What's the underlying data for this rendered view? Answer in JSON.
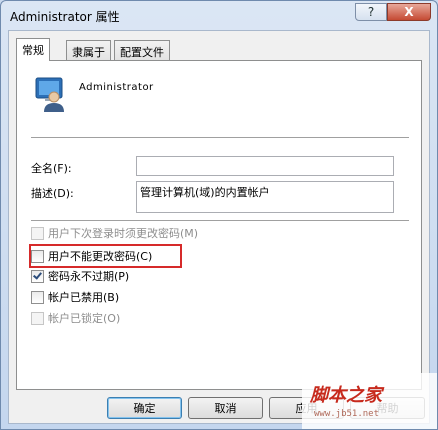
{
  "window": {
    "title": "Administrator 属性",
    "help_label": "?",
    "close_label": "X"
  },
  "tabs": [
    {
      "label": "常规",
      "active": true
    },
    {
      "label": "隶属于",
      "active": false
    },
    {
      "label": "配置文件",
      "active": false
    }
  ],
  "general": {
    "user_name": "Administrator",
    "full_name_label": "全名(F):",
    "full_name_value": "",
    "description_label": "描述(D):",
    "description_value": "管理计算机(域)的内置帐户",
    "checkboxes": [
      {
        "label": "用户下次登录时须更改密码(M)",
        "checked": false,
        "enabled": false
      },
      {
        "label": "用户不能更改密码(C)",
        "checked": false,
        "enabled": true
      },
      {
        "label": "密码永不过期(P)",
        "checked": true,
        "enabled": true
      },
      {
        "label": "帐户已禁用(B)",
        "checked": false,
        "enabled": true
      },
      {
        "label": "帐户已锁定(O)",
        "checked": false,
        "enabled": false
      }
    ]
  },
  "buttons": {
    "ok": "确定",
    "cancel": "取消",
    "apply": "应用",
    "help": "帮助"
  },
  "watermark": {
    "text": "脚本之家",
    "url": "www.jb51.net"
  },
  "colors": {
    "highlight": "#d62a2a",
    "check": "#2c4d7c"
  }
}
